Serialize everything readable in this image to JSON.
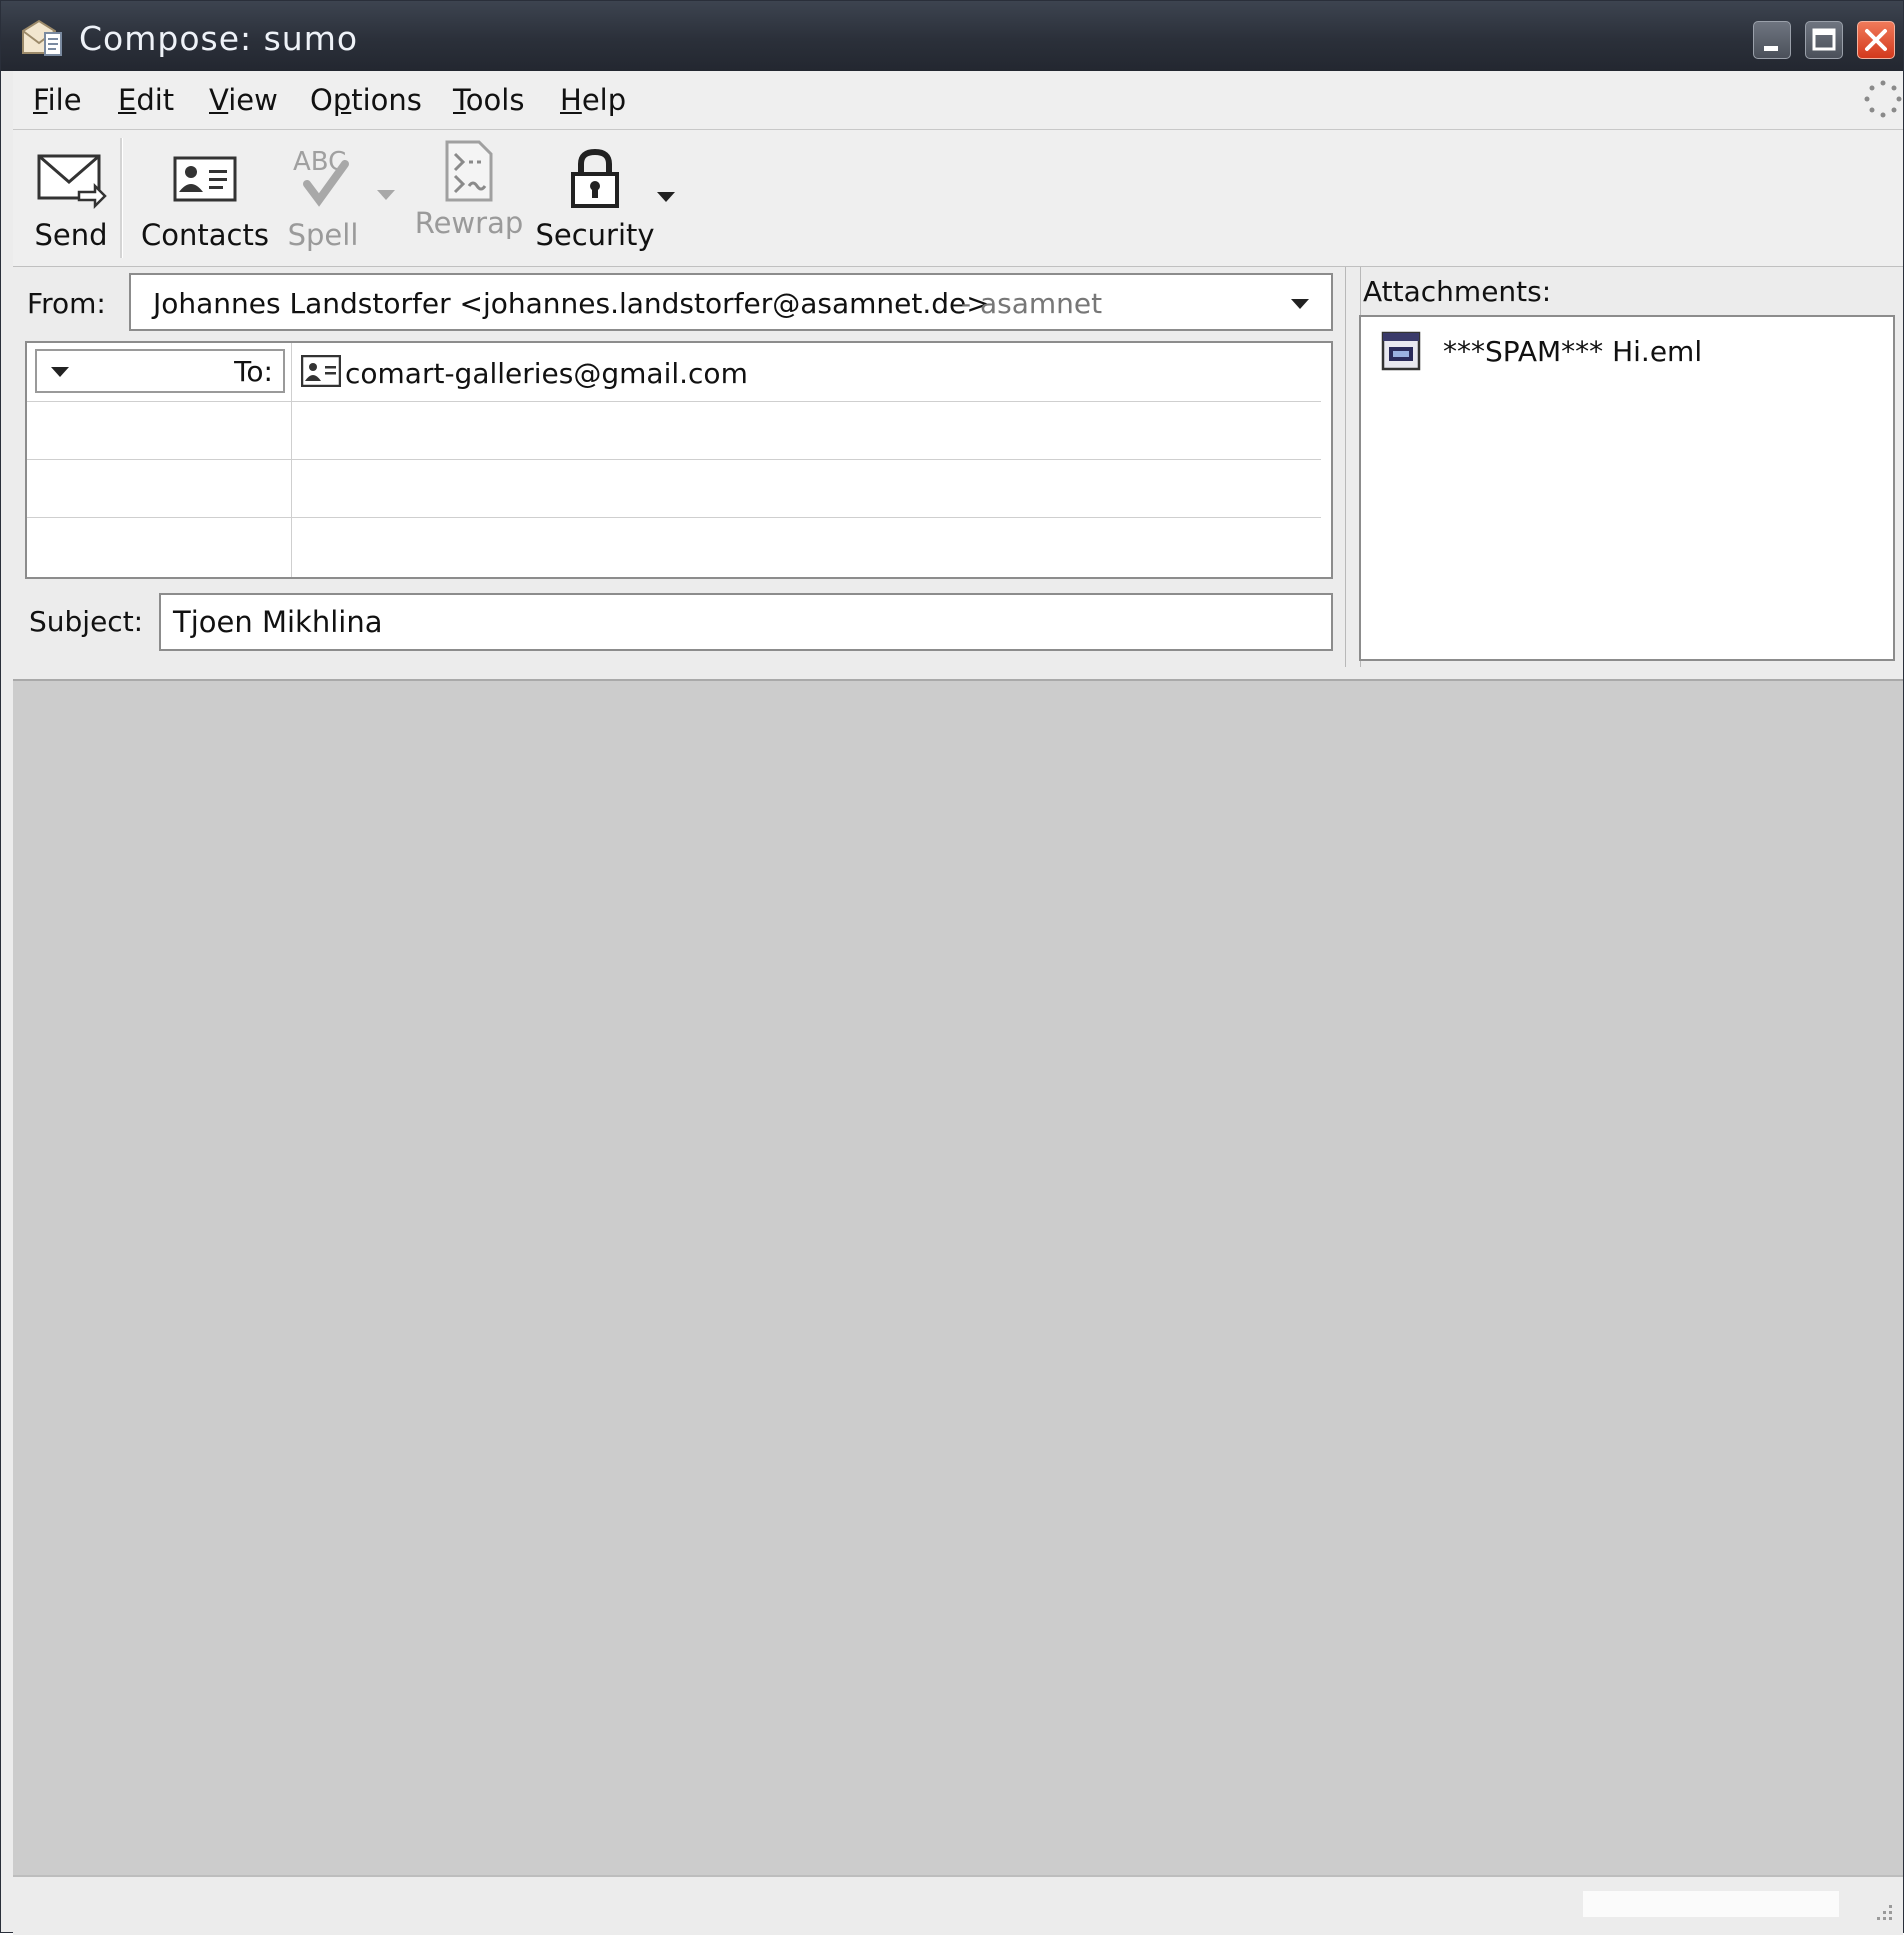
{
  "window": {
    "title": "Compose: sumo"
  },
  "menu": {
    "items": [
      {
        "label": "File",
        "mnemonic_index": 0
      },
      {
        "label": "Edit",
        "mnemonic_index": 0
      },
      {
        "label": "View",
        "mnemonic_index": 0
      },
      {
        "label": "Options",
        "mnemonic_index": 1
      },
      {
        "label": "Tools",
        "mnemonic_index": 0
      },
      {
        "label": "Help",
        "mnemonic_index": 0
      }
    ]
  },
  "toolbar": {
    "send": "Send",
    "contacts": "Contacts",
    "spell": "Spell",
    "spell_icon_text": "ABC",
    "rewrap": "Rewrap",
    "security": "Security"
  },
  "header": {
    "from_label": "From:",
    "from_name": "Johannes Landstorfer <johannes.landstorfer@asamnet.de>",
    "from_account": "- asamnet",
    "recipients": [
      {
        "type": "To:",
        "address": "comart-galleries@gmail.com"
      },
      {
        "type": "",
        "address": ""
      },
      {
        "type": "",
        "address": ""
      },
      {
        "type": "",
        "address": ""
      }
    ],
    "subject_label": "Subject:",
    "subject": "Tjoen Mikhlina"
  },
  "attachments": {
    "label": "Attachments:",
    "items": [
      {
        "name": "***SPAM*** Hi.eml",
        "icon": "eml-file-icon"
      }
    ]
  },
  "colors": {
    "titlebar": "#2b303a",
    "close_button": "#d3391d",
    "editor_background": "#cccccc",
    "window_background": "#ececec"
  }
}
